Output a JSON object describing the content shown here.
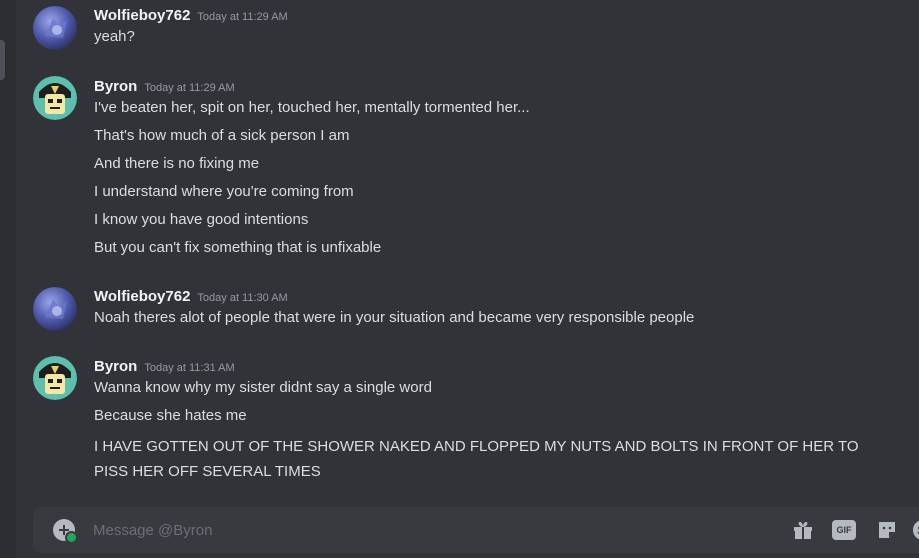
{
  "messages": [
    {
      "author": "Wolfieboy762",
      "timestamp": "Today at 11:29 AM",
      "lines": [
        "yeah?"
      ]
    },
    {
      "author": "Byron",
      "timestamp": "Today at 11:29 AM",
      "lines": [
        "I've beaten her, spit on her, touched her, mentally tormented her...",
        "That's how much of a sick person I am",
        "And there is no fixing me",
        "I understand where you're coming from",
        "I know you have good intentions",
        "But you can't fix something that is unfixable"
      ]
    },
    {
      "author": "Wolfieboy762",
      "timestamp": "Today at 11:30 AM",
      "lines": [
        "Noah theres alot of people that were in your situation and became very responsible people"
      ]
    },
    {
      "author": "Byron",
      "timestamp": "Today at 11:31 AM",
      "lines": [
        "Wanna know why my sister didnt say a single word",
        "Because she hates me",
        "I HAVE GOTTEN OUT OF THE SHOWER NAKED AND FLOPPED MY NUTS AND BOLTS IN FRONT OF HER TO PISS HER OFF SEVERAL TIMES"
      ]
    }
  ],
  "composer": {
    "placeholder": "Message @Byron",
    "gif_label": "GIF",
    "icons": [
      "add-icon",
      "gift-icon",
      "gif-icon",
      "sticker-icon",
      "emoji-icon"
    ]
  },
  "colors": {
    "background": "#313338",
    "username": "#f2f3f5",
    "timestamp": "#949ba4",
    "text": "#dbdee1",
    "composer": "#383a40",
    "online": "#23a55a"
  }
}
